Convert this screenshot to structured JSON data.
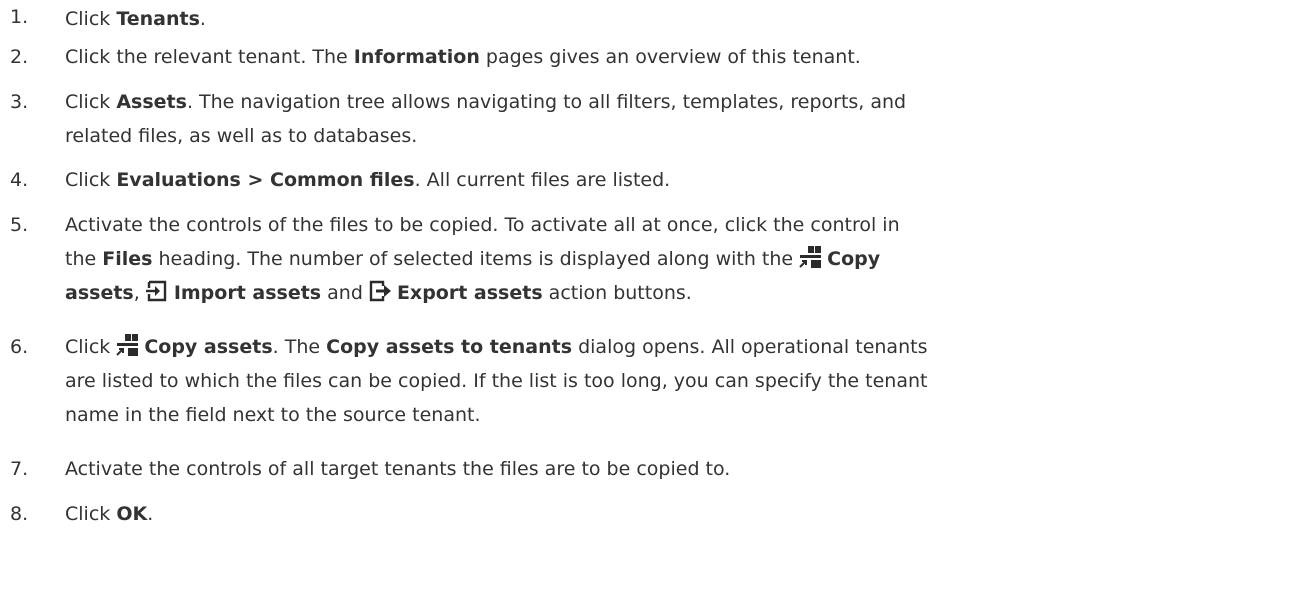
{
  "steps": [
    {
      "num": "1.",
      "pre": "Click ",
      "b1": "Tenants",
      "post": "."
    },
    {
      "num": "2.",
      "pre": "Click the relevant tenant. The ",
      "b1": "Information",
      "post": " pages gives an overview of this tenant."
    },
    {
      "num": "3.",
      "pre": "Click ",
      "b1": "Assets",
      "post": ". The navigation tree allows navigating to all filters, templates, reports, and",
      "line2": "related files, as well as to databases."
    },
    {
      "num": "4.",
      "pre": "Click ",
      "b1": "Evaluations > Common files",
      "post": ". All current files are listed."
    },
    {
      "num": "5.",
      "line1": "Activate the controls of the files to be copied. To activate all at once, click the control in",
      "l2_pre": "the ",
      "l2_b1": "Files",
      "l2_mid": " heading. The number of selected items is displayed along with the ",
      "l2_b2": "Copy",
      "l3_b1": "assets",
      "l3_sep1": ", ",
      "l3_b2": "Import assets",
      "l3_sep2": " and ",
      "l3_b3": "Export assets",
      "l3_post": " action buttons."
    },
    {
      "num": "6.",
      "pre": "Click ",
      "b1": "Copy assets",
      "mid": ". The ",
      "b2": "Copy assets to tenants",
      "post": " dialog opens. All operational tenants",
      "line2": "are listed to which the files can be copied. If the list is too long, you can specify the tenant",
      "line3": "name in the field next to the source tenant."
    },
    {
      "num": "7.",
      "text": "Activate the controls of all target tenants the files are to be copied to."
    },
    {
      "num": "8.",
      "pre": "Click ",
      "b1": "OK",
      "post": "."
    }
  ],
  "icons": {
    "copy": "copy-assets-icon",
    "import": "import-assets-icon",
    "export": "export-assets-icon"
  },
  "colors": {
    "text": "#333333",
    "icon": "#2b2b2b"
  }
}
